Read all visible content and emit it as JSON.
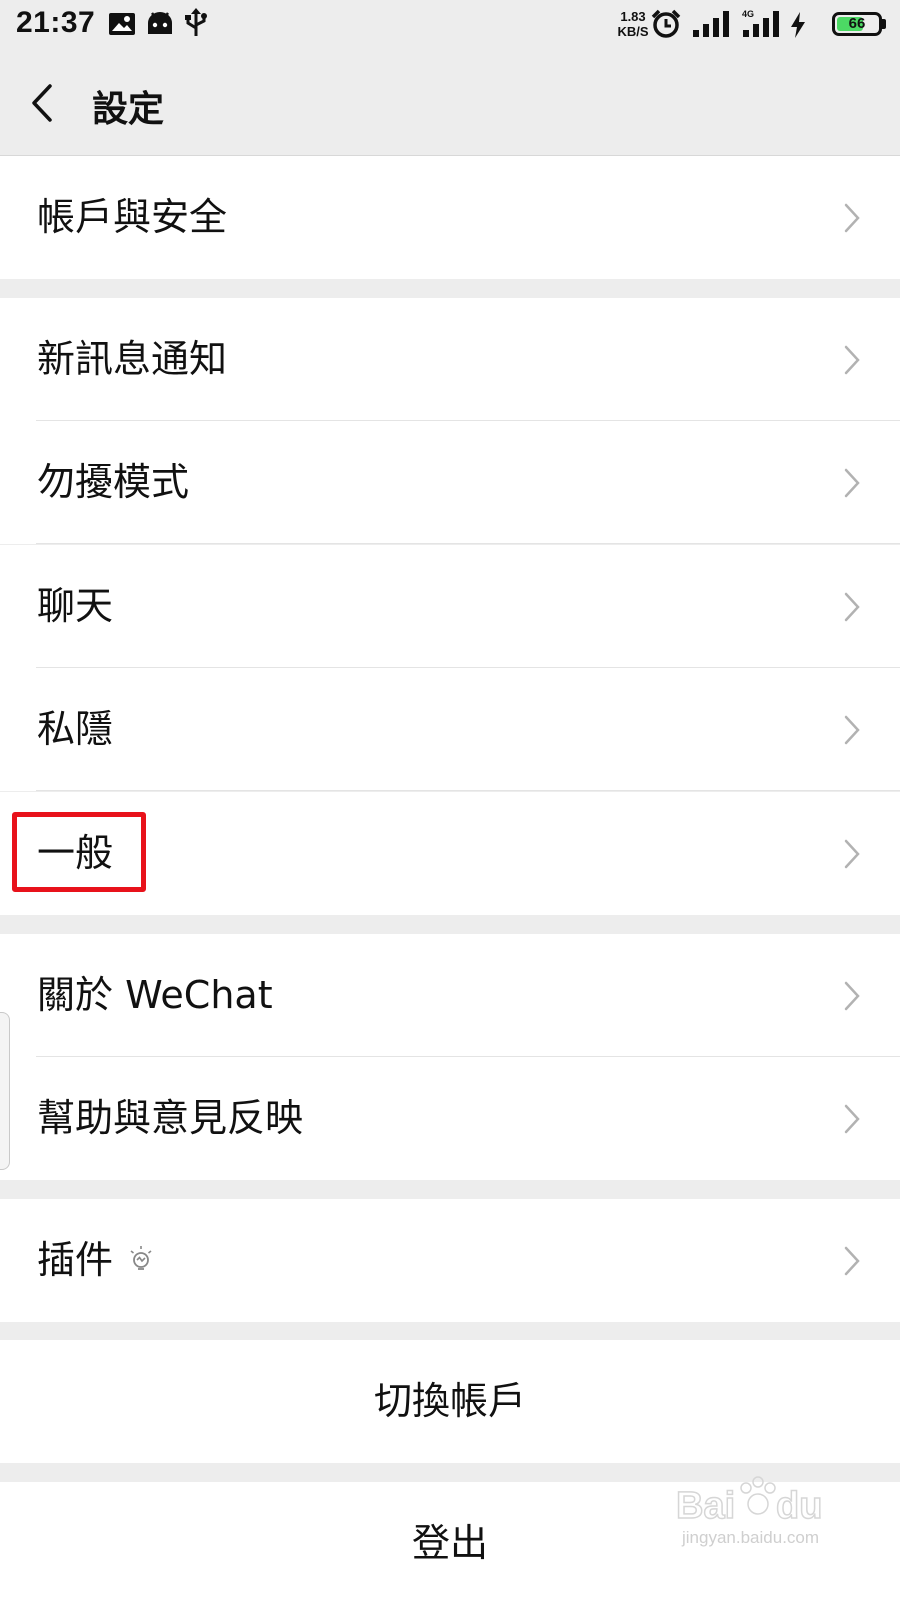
{
  "status_bar": {
    "time": "21:37",
    "net_speed_value": "1.83",
    "net_speed_unit": "KB/S",
    "network_type": "4G",
    "battery_level": "66",
    "battery_fraction": 0.66
  },
  "header": {
    "title": "設定"
  },
  "groups": [
    {
      "items": [
        {
          "label": "帳戶與安全"
        }
      ]
    },
    {
      "items": [
        {
          "label": "新訊息通知"
        },
        {
          "label": "勿擾模式"
        },
        {
          "label": "聊天"
        },
        {
          "label": "私隱"
        },
        {
          "label": "一般"
        }
      ]
    },
    {
      "items": [
        {
          "label": "關於 WeChat"
        },
        {
          "label": "幫助與意見反映"
        }
      ]
    },
    {
      "items": [
        {
          "label": "插件"
        }
      ]
    }
  ],
  "actions": {
    "switch_account": "切換帳戶",
    "logout": "登出"
  },
  "watermark": {
    "text": "jingyan.baidu.com"
  },
  "colors": {
    "highlight": "#e8121b",
    "battery_green": "#4cd964",
    "background": "#ededed"
  }
}
